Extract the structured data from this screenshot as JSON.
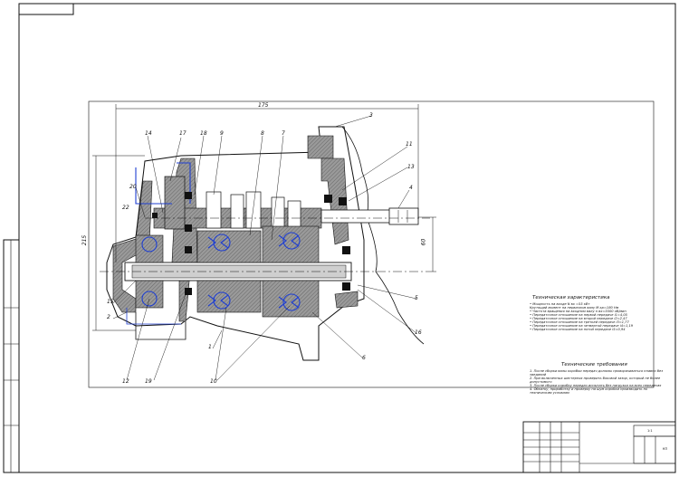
{
  "drawing": {
    "dimensions": {
      "overall_width": "175",
      "height_left": "215",
      "shaft_offset": "60"
    },
    "callouts": [
      {
        "label": "1"
      },
      {
        "label": "2"
      },
      {
        "label": "3"
      },
      {
        "label": "4"
      },
      {
        "label": "5"
      },
      {
        "label": "6"
      },
      {
        "label": "7"
      },
      {
        "label": "8"
      },
      {
        "label": "9"
      },
      {
        "label": "10"
      },
      {
        "label": "11"
      },
      {
        "label": "12"
      },
      {
        "label": "13"
      },
      {
        "label": "14"
      },
      {
        "label": "15"
      },
      {
        "label": "16"
      },
      {
        "label": "17"
      },
      {
        "label": "18"
      },
      {
        "label": "19"
      },
      {
        "label": "20"
      },
      {
        "label": "22"
      }
    ]
  },
  "technical_characteristics": {
    "title": "Техническая характеристика",
    "lines": [
      "• Мощность на входе N вх =55 кВт",
      "  Крутящий момент на первичном валу M кр=180 Нм",
      "• Частота вращения на входном валу n вх=5500 об/мин",
      "• Передаточное отношение на первой передаче i1=4,05",
      "• Передаточное отношение на второй передаче i2=2,47",
      "• Передаточное отношение на третьей передаче i3=1,77",
      "• Передаточное отношение на четвертой передаче i4=1,19",
      "• Передаточное отношение на пятой передаче i5=0,94"
    ]
  },
  "technical_requirements": {
    "title": "Технические требования",
    "lines": [
      "1. После сборки валы коробки передач должны проворачиваться плавно без заеданий",
      "2. При включенных шестернях проверить боковой зазор, который не более допустимого",
      "3. После сборки коробку передач испытать без нагрузки на всех передачах",
      "4. Обкатку, приработку и проверку на шум коробки производить по техническим условиям"
    ]
  },
  "title_block": {
    "sheet_label": "КП",
    "scale": "1:1"
  },
  "colors": {
    "section_fill": "#8a8a8a",
    "bearing_blue": "#1f3fd1",
    "line_black": "#111111"
  }
}
